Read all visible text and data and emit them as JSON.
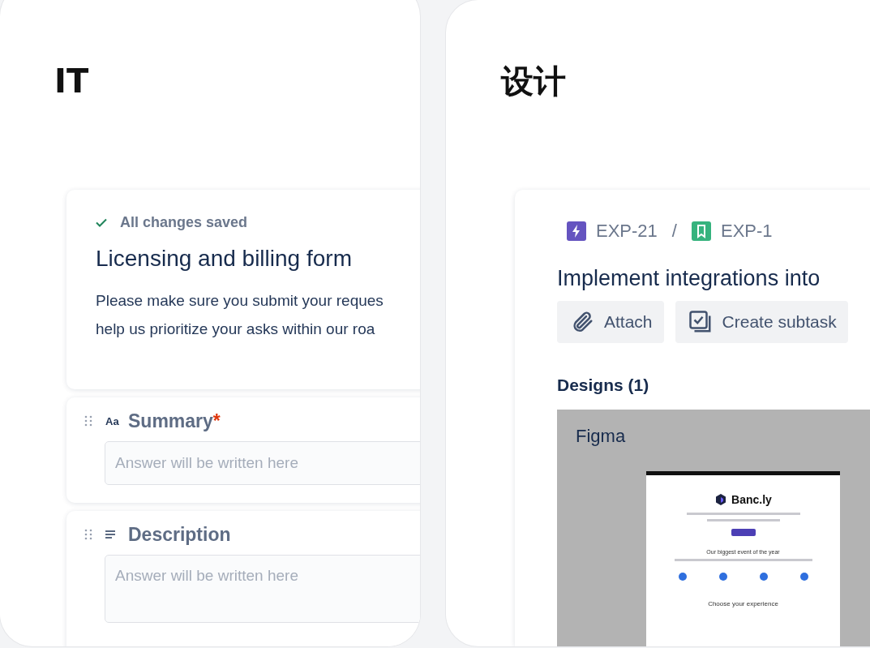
{
  "cards": [
    {
      "kind": "form",
      "heading": "IT",
      "form": {
        "status": "All changes saved",
        "title": "Licensing and billing form",
        "description_lines": [
          "Please make sure you submit your reques",
          "help us prioritize your asks within our roa"
        ],
        "fields": [
          {
            "kind": "text",
            "icon_text": "Aa",
            "label": "Summary",
            "required_mark": "*",
            "placeholder": "Answer will be written here"
          },
          {
            "kind": "paragraph",
            "label": "Description",
            "placeholder": "Answer will be written here"
          }
        ]
      }
    },
    {
      "kind": "issue",
      "heading": "设计",
      "issue": {
        "breadcrumbs": [
          {
            "kind": "epic",
            "key": "EXP-21",
            "color": "#6554c0"
          },
          {
            "kind": "story",
            "key": "EXP-1",
            "color": "#36b37e"
          }
        ],
        "separator": "/",
        "title": "Implement integrations into",
        "actions": [
          {
            "kind": "attach",
            "label": "Attach"
          },
          {
            "kind": "subtask",
            "label": "Create subtask"
          }
        ],
        "designs": {
          "heading": "Designs (1)",
          "source": "Figma",
          "preview": {
            "brand": "Banc.ly",
            "section_title": "Our biggest event of the year",
            "footer_title": "Choose your experience"
          }
        }
      }
    }
  ]
}
